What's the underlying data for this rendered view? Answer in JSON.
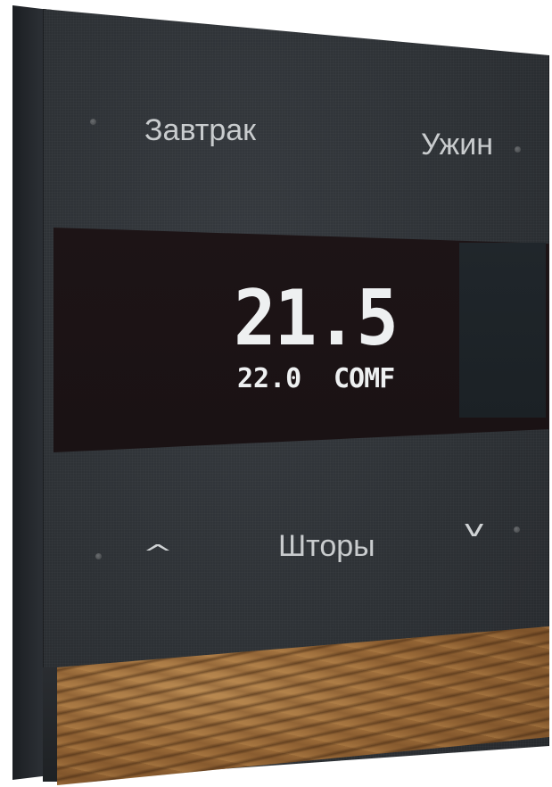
{
  "buttons": {
    "top_left_label": "Завтрак",
    "top_right_label": "Ужин",
    "bottom_label": "Шторы",
    "up_arrow_icon": "chevron-up",
    "down_arrow_icon": "chevron-down",
    "up_arrow_glyph": "^",
    "down_arrow_glyph": "v"
  },
  "display": {
    "current_temperature": "21.5",
    "setpoint": "22.0",
    "mode": "COMF"
  },
  "colors": {
    "panel": "#2f3337",
    "display_background": "#1a1214",
    "display_text": "#eef0f1",
    "label_text": "#c9ccce",
    "wood": "#9a6a38"
  }
}
